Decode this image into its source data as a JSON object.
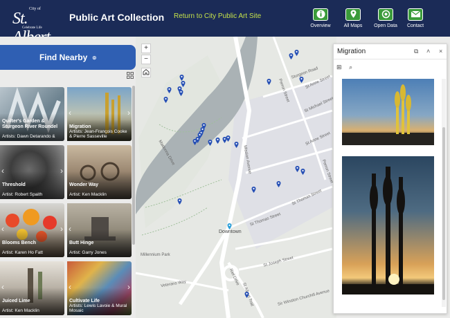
{
  "header": {
    "logo_city": "City of",
    "logo_word": "St. Albert",
    "logo_tag": "Celebrate Life",
    "title": "Public Art Collection",
    "return_link": "Return to City Public Art Site",
    "buttons": [
      {
        "label": "Overview",
        "icon": "info-icon"
      },
      {
        "label": "All Maps",
        "icon": "map-pin-icon"
      },
      {
        "label": "Open Data",
        "icon": "open-data-icon"
      },
      {
        "label": "Contact",
        "icon": "envelope-icon"
      }
    ]
  },
  "left_panel": {
    "find_nearby_label": "Find Nearby",
    "cards": [
      {
        "title": "Quilter's Garden & Sturgeon River Roundel",
        "artists": "Artists: Dawn Detarando &"
      },
      {
        "title": "Migration",
        "artists": "Artists: Jean-François Cooke & Pierre Sasseville"
      },
      {
        "title": "Threshold",
        "artists": "Artist: Robert Spaith"
      },
      {
        "title": "Wonder Way",
        "artists": "Artist: Ken Macklin"
      },
      {
        "title": "Blooms Bench",
        "artists": "Artist: Karen Ho Fatt"
      },
      {
        "title": "Butt Hinge",
        "artists": "Artist: Garry Jones"
      },
      {
        "title": "Juiced Lime",
        "artists": "Artist: Ken Macklin"
      },
      {
        "title": "Cultivate Life",
        "artists": "Artists: Lewis Lavoie & Mural Mosaic"
      }
    ]
  },
  "map": {
    "zoom_in": "+",
    "zoom_out": "−",
    "labels": {
      "downtown": "Downtown",
      "millennium_park": "Millennium Park",
      "st_anne_1": "St Anne Street",
      "st_anne_2": "St Anne Street",
      "st_michael": "St Michael Street",
      "perron_1": "Perron Street",
      "perron_2": "Perron Street",
      "st_thomas_1": "St Thomas Street",
      "st_thomas_2": "St Thomas Street",
      "st_joseph": "St Joseph Street",
      "sir_winston": "Sir Winston Churchill Avenue",
      "riel": "Riel Drive",
      "veterans": "Veterans Way",
      "st_albert_trail": "St Albert Trail",
      "madonna": "Madonna Drive",
      "mission": "Mission Avenue",
      "sturgeon": "Sturgeon Road"
    }
  },
  "right_panel": {
    "title": "Migration"
  },
  "colors": {
    "header_bg": "#1b2b57",
    "accent_blue": "#2f5fb3",
    "return_link": "#c6e34a",
    "pin_blue": "#2750b5",
    "pin_selected": "#2a9fd9",
    "river": "#aab2b5"
  }
}
